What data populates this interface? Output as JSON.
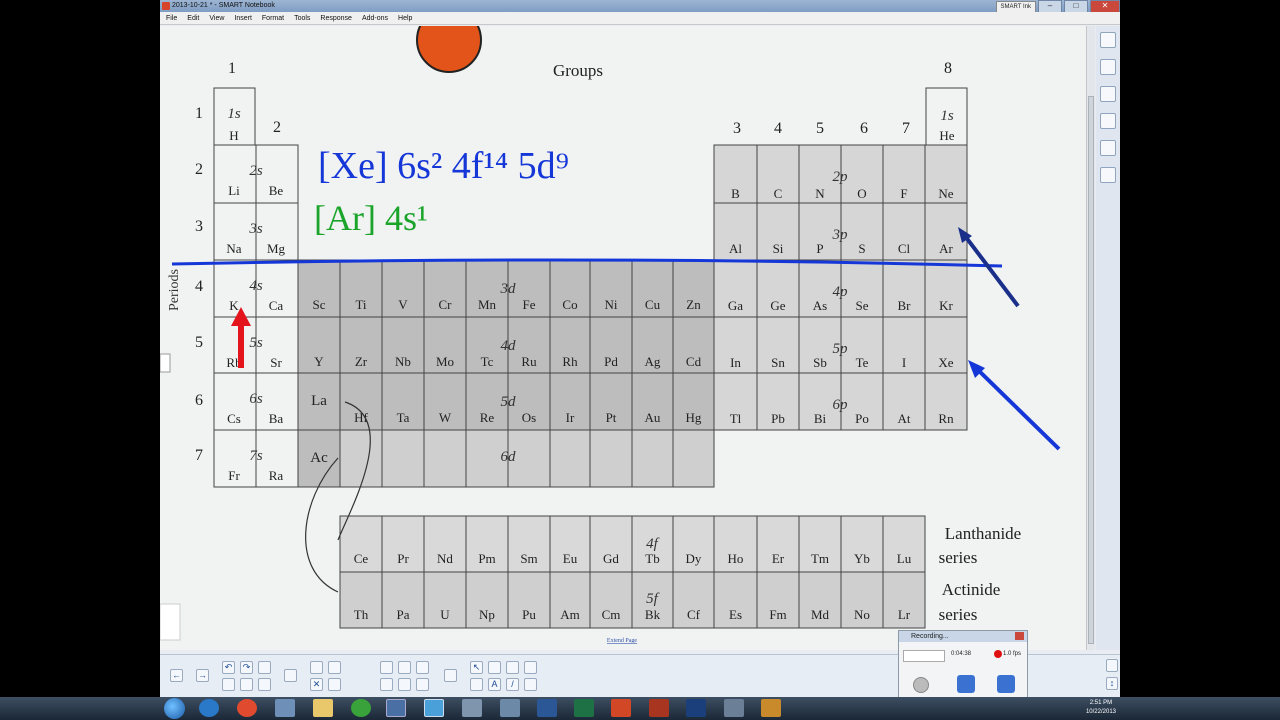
{
  "window": {
    "title": "2013-10-21 * - SMART Notebook",
    "smart_ink_label": "SMART Ink"
  },
  "menu": [
    "File",
    "Edit",
    "View",
    "Insert",
    "Format",
    "Tools",
    "Response",
    "Add-ons",
    "Help"
  ],
  "periodic_table": {
    "header_groups": "Groups",
    "header_periods": "Periods",
    "group_labels": {
      "g1": "1",
      "g2": "2",
      "g3": "3",
      "g4": "4",
      "g5": "5",
      "g6": "6",
      "g7": "7",
      "g8": "8"
    },
    "period_labels": [
      "1",
      "2",
      "3",
      "4",
      "5",
      "6",
      "7"
    ],
    "block_labels": {
      "s1": "1s",
      "s2": "2s",
      "s3": "3s",
      "s4": "4s",
      "s5": "5s",
      "s6": "6s",
      "s7": "7s",
      "p2": "2p",
      "p3": "3p",
      "p4": "4p",
      "p5": "5p",
      "p6": "6p",
      "d3": "3d",
      "d4": "4d",
      "d5": "5d",
      "d6": "6d",
      "f4": "4f",
      "f5": "5f",
      "he_sub": "1s"
    },
    "s_block": [
      [
        "H"
      ],
      [
        "Li",
        "Be"
      ],
      [
        "Na",
        "Mg"
      ],
      [
        "K",
        "Ca"
      ],
      [
        "Rb",
        "Sr"
      ],
      [
        "Cs",
        "Ba"
      ],
      [
        "Fr",
        "Ra"
      ]
    ],
    "he": "He",
    "p_block": [
      [
        "B",
        "C",
        "N",
        "O",
        "F",
        "Ne"
      ],
      [
        "Al",
        "Si",
        "P",
        "S",
        "Cl",
        "Ar"
      ],
      [
        "Ga",
        "Ge",
        "As",
        "Se",
        "Br",
        "Kr"
      ],
      [
        "In",
        "Sn",
        "Sb",
        "Te",
        "I",
        "Xe"
      ],
      [
        "Tl",
        "Pb",
        "Bi",
        "Po",
        "At",
        "Rn"
      ]
    ],
    "d_block": [
      [
        "Sc",
        "Ti",
        "V",
        "Cr",
        "Mn",
        "Fe",
        "Co",
        "Ni",
        "Cu",
        "Zn"
      ],
      [
        "Y",
        "Zr",
        "Nb",
        "Mo",
        "Tc",
        "Ru",
        "Rh",
        "Pd",
        "Ag",
        "Cd"
      ],
      [
        "La",
        "Hf",
        "Ta",
        "W",
        "Re",
        "Os",
        "Ir",
        "Pt",
        "Au",
        "Hg"
      ],
      [
        "Ac"
      ]
    ],
    "lanthanides": [
      "Ce",
      "Pr",
      "Nd",
      "Pm",
      "Sm",
      "Eu",
      "Gd",
      "Tb",
      "Dy",
      "Ho",
      "Er",
      "Tm",
      "Yb",
      "Lu"
    ],
    "actinides": [
      "Th",
      "Pa",
      "U",
      "Np",
      "Pu",
      "Am",
      "Cm",
      "Bk",
      "Cf",
      "Es",
      "Fm",
      "Md",
      "No",
      "Lr"
    ],
    "lanthanide_label_1": "Lanthanide",
    "lanthanide_label_2": "series",
    "actinide_label_1": "Actinide",
    "actinide_label_2": "series"
  },
  "ink": {
    "xe_config": "[Xe] 6s² 4f¹⁴ 5d⁹",
    "ar_config": "[Ar] 4s¹",
    "colors": {
      "blue": "#1537d8",
      "green": "#1aa52a",
      "red": "#e3141b",
      "orange": "#e2541a"
    }
  },
  "extend_page": "Extend Page",
  "recording": {
    "title": "Recording...",
    "time": "0:04:38",
    "fps": "1.0 fps"
  },
  "clock": {
    "time": "2:51 PM",
    "date": "10/22/2013"
  }
}
